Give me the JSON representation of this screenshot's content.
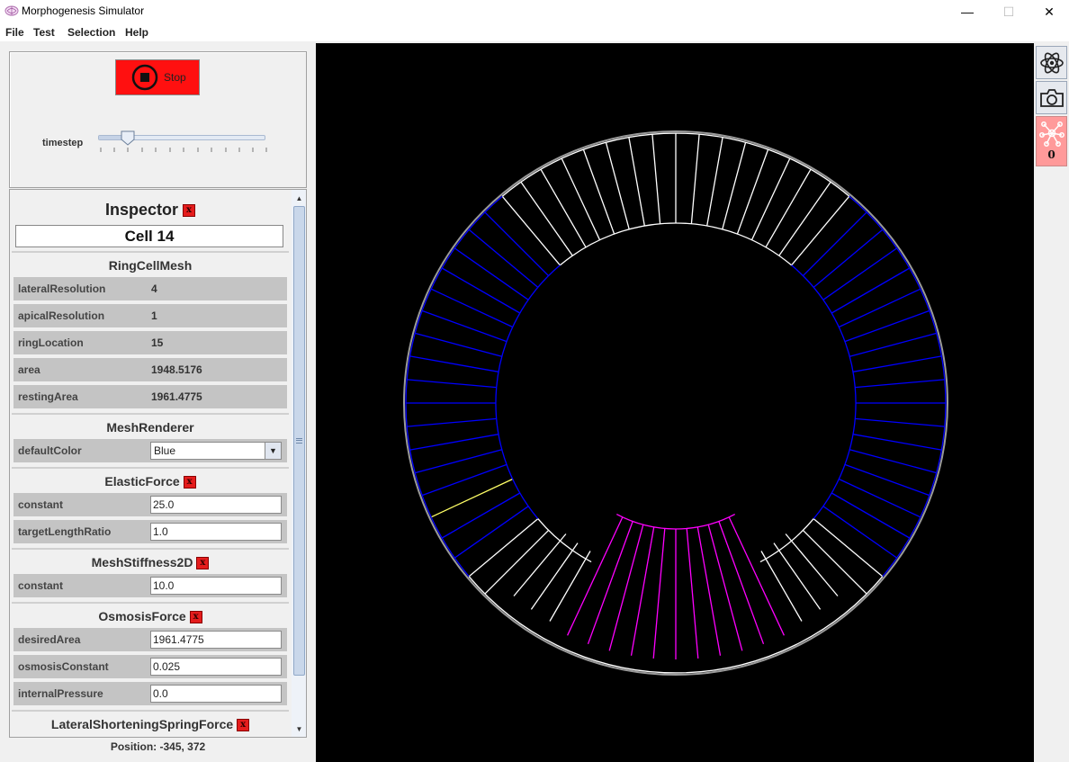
{
  "window": {
    "title": "Morphogenesis Simulator",
    "minimize": "—",
    "maximize": "☐",
    "close": "✕"
  },
  "menu": [
    "File",
    "Test",
    "Selection",
    "Help"
  ],
  "controls": {
    "stop_label": "Stop",
    "timestep_label": "timestep",
    "timestep_level_fraction": 0.17
  },
  "inspector": {
    "title": "Inspector",
    "remove_glyph": "x",
    "cell_name": "Cell 14",
    "sections": {
      "ring": {
        "header": "RingCellMesh",
        "rows": [
          {
            "label": "lateralResolution",
            "value": "4"
          },
          {
            "label": "apicalResolution",
            "value": "1"
          },
          {
            "label": "ringLocation",
            "value": "15"
          },
          {
            "label": "area",
            "value": "1948.5176"
          },
          {
            "label": "restingArea",
            "value": "1961.4775"
          }
        ]
      },
      "renderer": {
        "header": "MeshRenderer",
        "rows": [
          {
            "label": "defaultColor",
            "value": "Blue"
          }
        ]
      },
      "elastic": {
        "header": "ElasticForce",
        "rows": [
          {
            "label": "constant",
            "value": "25.0"
          },
          {
            "label": "targetLengthRatio",
            "value": "1.0"
          }
        ]
      },
      "stiffness": {
        "header": "MeshStiffness2D",
        "rows": [
          {
            "label": "constant",
            "value": "10.0"
          }
        ]
      },
      "osmosis": {
        "header": "OsmosisForce",
        "rows": [
          {
            "label": "desiredArea",
            "value": "1961.4775"
          },
          {
            "label": "osmosisConstant",
            "value": "0.025"
          },
          {
            "label": "internalPressure",
            "value": "0.0"
          }
        ]
      },
      "lateral": {
        "header": "LateralShorteningSpringForce"
      }
    }
  },
  "status": {
    "position": "Position: -345, 372"
  },
  "toolbar": {
    "atom_icon": "atom-icon",
    "camera_icon": "camera-icon",
    "network_icon": "network-icon",
    "network_count": "0"
  },
  "colors": {
    "stop_button": "#ff1010",
    "canvas_bg": "#000000",
    "cell_default": "#0000ff",
    "cell_white": "#ffffff",
    "cell_selected": "#ff00ff",
    "cell_yellow": "#ffff66",
    "boundary": "#9a9a9a",
    "network_button": "#ff9a9a"
  }
}
